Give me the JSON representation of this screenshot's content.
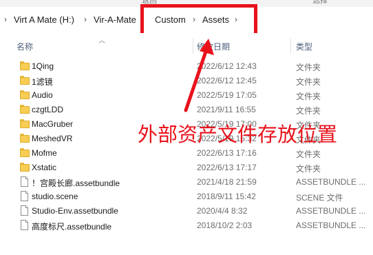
{
  "ribbon": {
    "partial_left": "返回",
    "partial_right": "选择"
  },
  "breadcrumb": {
    "items": [
      "Virt A Mate (H:)",
      "Vir-A-Mate",
      "Custom",
      "Assets"
    ],
    "separator": "›",
    "left_chevron": "›"
  },
  "columns": {
    "name": "名称",
    "date": "修改日期",
    "type": "类型"
  },
  "files": [
    {
      "icon": "folder-icon",
      "name": "1Qing",
      "date": "2022/6/12 12:43",
      "type": "文件夹"
    },
    {
      "icon": "folder-icon",
      "name": "1滤镜",
      "date": "2022/6/12 12:45",
      "type": "文件夹"
    },
    {
      "icon": "folder-icon",
      "name": "Audio",
      "date": "2022/5/19 17:05",
      "type": "文件夹"
    },
    {
      "icon": "folder-icon",
      "name": "czgtLDD",
      "date": "2021/9/11 16:55",
      "type": "文件夹"
    },
    {
      "icon": "folder-icon",
      "name": "MacGruber",
      "date": "2022/5/19 17:00",
      "type": "文件夹"
    },
    {
      "icon": "folder-icon",
      "name": "MeshedVR",
      "date": "2022/5/19 15:32",
      "type": "文件夹"
    },
    {
      "icon": "folder-icon",
      "name": "Mofme",
      "date": "2022/6/13 17:16",
      "type": "文件夹"
    },
    {
      "icon": "folder-icon",
      "name": "Xstatic",
      "date": "2022/6/13 17:17",
      "type": "文件夹"
    },
    {
      "icon": "file-icon",
      "name": "！宫殿长廊.assetbundle",
      "date": "2021/4/18 21:59",
      "type": "ASSETBUNDLE ..."
    },
    {
      "icon": "file-icon",
      "name": "studio.scene",
      "date": "2018/9/11 15:42",
      "type": "SCENE 文件"
    },
    {
      "icon": "file-icon",
      "name": "Studio-Env.assetbundle",
      "date": "2020/4/4 8:32",
      "type": "ASSETBUNDLE ..."
    },
    {
      "icon": "file-icon",
      "name": "高度标尺.assetbundle",
      "date": "2018/10/2 2:03",
      "type": "ASSETBUNDLE ..."
    }
  ],
  "annotation": {
    "text": "外部资产文件存放位置",
    "color": "#e8121b"
  },
  "colors": {
    "folder": "#f7cd53",
    "header_text": "#4c607a",
    "meta_text": "#6d6d6d"
  }
}
